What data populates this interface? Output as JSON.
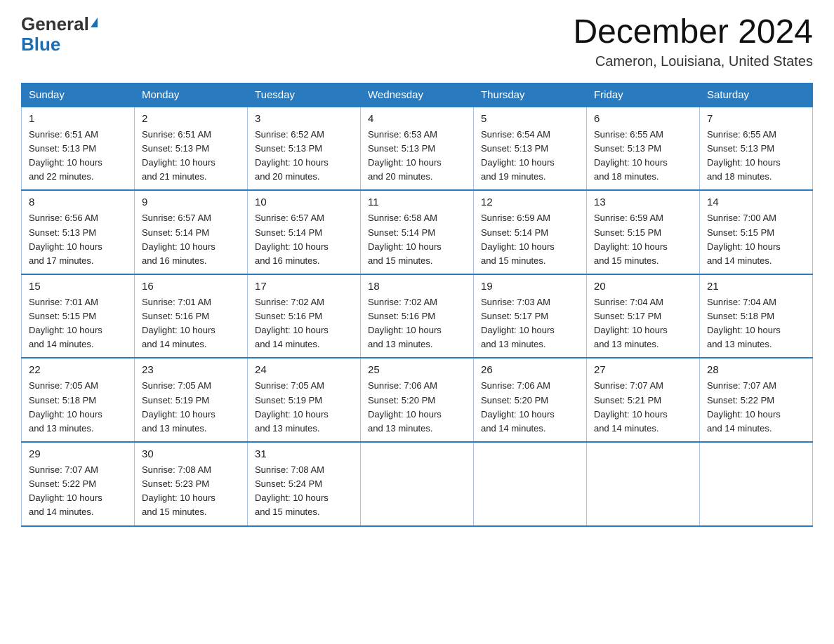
{
  "logo": {
    "general": "General",
    "blue": "Blue"
  },
  "header": {
    "month": "December 2024",
    "location": "Cameron, Louisiana, United States"
  },
  "weekdays": [
    "Sunday",
    "Monday",
    "Tuesday",
    "Wednesday",
    "Thursday",
    "Friday",
    "Saturday"
  ],
  "weeks": [
    [
      {
        "day": "1",
        "sunrise": "6:51 AM",
        "sunset": "5:13 PM",
        "daylight": "10 hours and 22 minutes."
      },
      {
        "day": "2",
        "sunrise": "6:51 AM",
        "sunset": "5:13 PM",
        "daylight": "10 hours and 21 minutes."
      },
      {
        "day": "3",
        "sunrise": "6:52 AM",
        "sunset": "5:13 PM",
        "daylight": "10 hours and 20 minutes."
      },
      {
        "day": "4",
        "sunrise": "6:53 AM",
        "sunset": "5:13 PM",
        "daylight": "10 hours and 20 minutes."
      },
      {
        "day": "5",
        "sunrise": "6:54 AM",
        "sunset": "5:13 PM",
        "daylight": "10 hours and 19 minutes."
      },
      {
        "day": "6",
        "sunrise": "6:55 AM",
        "sunset": "5:13 PM",
        "daylight": "10 hours and 18 minutes."
      },
      {
        "day": "7",
        "sunrise": "6:55 AM",
        "sunset": "5:13 PM",
        "daylight": "10 hours and 18 minutes."
      }
    ],
    [
      {
        "day": "8",
        "sunrise": "6:56 AM",
        "sunset": "5:13 PM",
        "daylight": "10 hours and 17 minutes."
      },
      {
        "day": "9",
        "sunrise": "6:57 AM",
        "sunset": "5:14 PM",
        "daylight": "10 hours and 16 minutes."
      },
      {
        "day": "10",
        "sunrise": "6:57 AM",
        "sunset": "5:14 PM",
        "daylight": "10 hours and 16 minutes."
      },
      {
        "day": "11",
        "sunrise": "6:58 AM",
        "sunset": "5:14 PM",
        "daylight": "10 hours and 15 minutes."
      },
      {
        "day": "12",
        "sunrise": "6:59 AM",
        "sunset": "5:14 PM",
        "daylight": "10 hours and 15 minutes."
      },
      {
        "day": "13",
        "sunrise": "6:59 AM",
        "sunset": "5:15 PM",
        "daylight": "10 hours and 15 minutes."
      },
      {
        "day": "14",
        "sunrise": "7:00 AM",
        "sunset": "5:15 PM",
        "daylight": "10 hours and 14 minutes."
      }
    ],
    [
      {
        "day": "15",
        "sunrise": "7:01 AM",
        "sunset": "5:15 PM",
        "daylight": "10 hours and 14 minutes."
      },
      {
        "day": "16",
        "sunrise": "7:01 AM",
        "sunset": "5:16 PM",
        "daylight": "10 hours and 14 minutes."
      },
      {
        "day": "17",
        "sunrise": "7:02 AM",
        "sunset": "5:16 PM",
        "daylight": "10 hours and 14 minutes."
      },
      {
        "day": "18",
        "sunrise": "7:02 AM",
        "sunset": "5:16 PM",
        "daylight": "10 hours and 13 minutes."
      },
      {
        "day": "19",
        "sunrise": "7:03 AM",
        "sunset": "5:17 PM",
        "daylight": "10 hours and 13 minutes."
      },
      {
        "day": "20",
        "sunrise": "7:04 AM",
        "sunset": "5:17 PM",
        "daylight": "10 hours and 13 minutes."
      },
      {
        "day": "21",
        "sunrise": "7:04 AM",
        "sunset": "5:18 PM",
        "daylight": "10 hours and 13 minutes."
      }
    ],
    [
      {
        "day": "22",
        "sunrise": "7:05 AM",
        "sunset": "5:18 PM",
        "daylight": "10 hours and 13 minutes."
      },
      {
        "day": "23",
        "sunrise": "7:05 AM",
        "sunset": "5:19 PM",
        "daylight": "10 hours and 13 minutes."
      },
      {
        "day": "24",
        "sunrise": "7:05 AM",
        "sunset": "5:19 PM",
        "daylight": "10 hours and 13 minutes."
      },
      {
        "day": "25",
        "sunrise": "7:06 AM",
        "sunset": "5:20 PM",
        "daylight": "10 hours and 13 minutes."
      },
      {
        "day": "26",
        "sunrise": "7:06 AM",
        "sunset": "5:20 PM",
        "daylight": "10 hours and 14 minutes."
      },
      {
        "day": "27",
        "sunrise": "7:07 AM",
        "sunset": "5:21 PM",
        "daylight": "10 hours and 14 minutes."
      },
      {
        "day": "28",
        "sunrise": "7:07 AM",
        "sunset": "5:22 PM",
        "daylight": "10 hours and 14 minutes."
      }
    ],
    [
      {
        "day": "29",
        "sunrise": "7:07 AM",
        "sunset": "5:22 PM",
        "daylight": "10 hours and 14 minutes."
      },
      {
        "day": "30",
        "sunrise": "7:08 AM",
        "sunset": "5:23 PM",
        "daylight": "10 hours and 15 minutes."
      },
      {
        "day": "31",
        "sunrise": "7:08 AM",
        "sunset": "5:24 PM",
        "daylight": "10 hours and 15 minutes."
      },
      null,
      null,
      null,
      null
    ]
  ],
  "labels": {
    "sunrise": "Sunrise:",
    "sunset": "Sunset:",
    "daylight": "Daylight:"
  }
}
